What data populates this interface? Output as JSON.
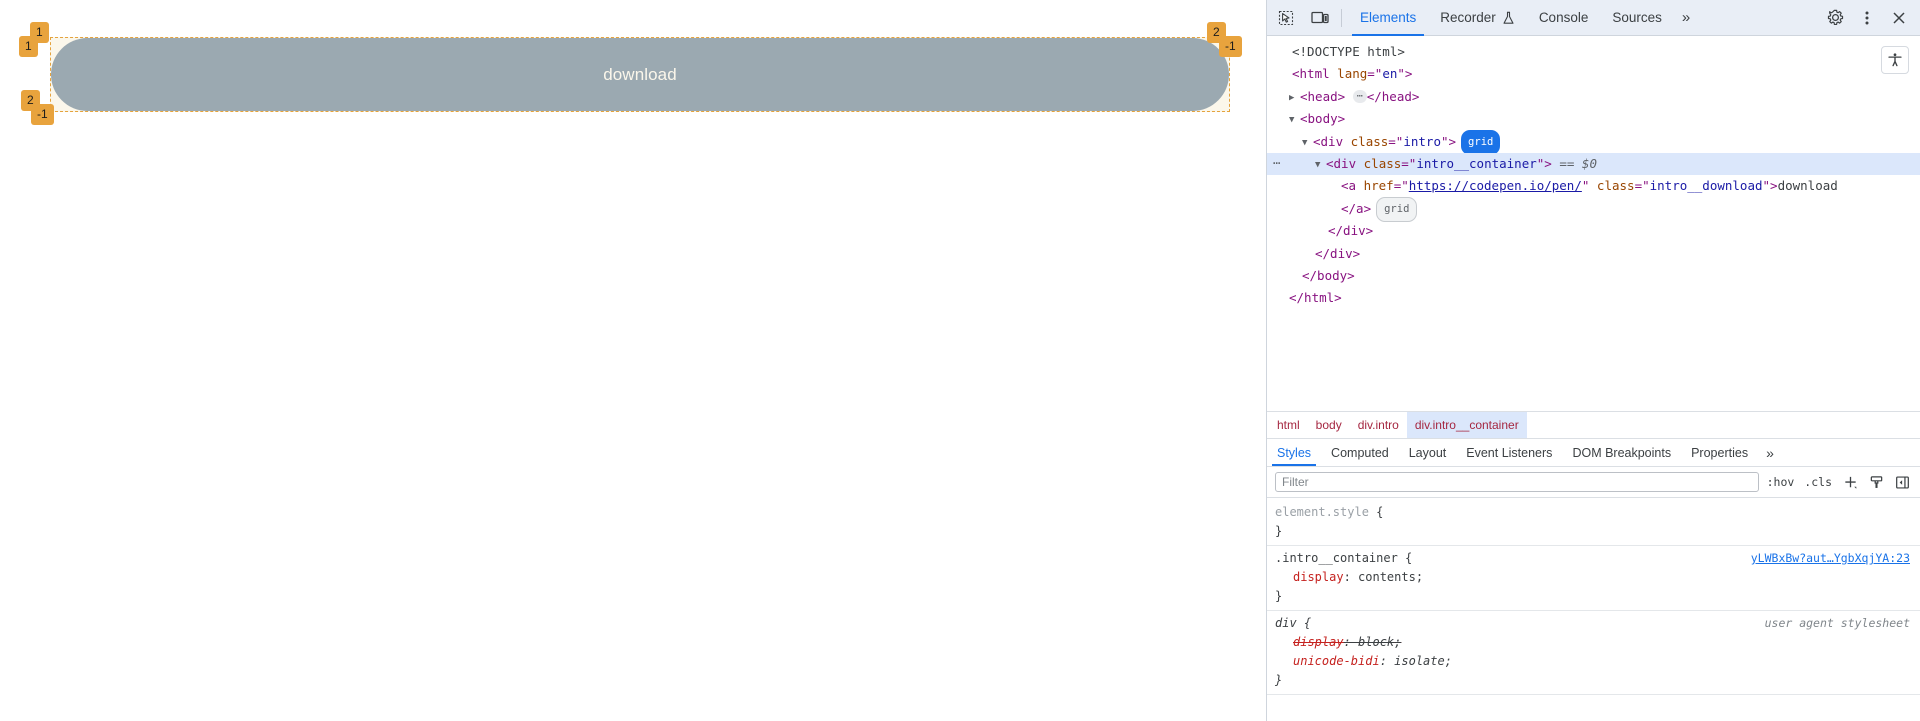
{
  "page": {
    "download_label": "download",
    "download_href": "https://codepen.io/pen/",
    "accent_blue": "#2b527e",
    "grid_overlay_color": "#e8a33d",
    "grid_badges": [
      {
        "label": "1"
      },
      {
        "label": "1"
      },
      {
        "label": "2"
      },
      {
        "label": "-1"
      },
      {
        "label": "2"
      },
      {
        "label": "-1"
      }
    ]
  },
  "devtools": {
    "toolbar": {
      "inspect_icon": "inspect-cursor-icon",
      "device_icon": "device-toolbar-icon",
      "tabs": [
        {
          "label": "Elements",
          "active": true
        },
        {
          "label": "Recorder",
          "active": false,
          "icon": "flask-icon"
        },
        {
          "label": "Console",
          "active": false
        },
        {
          "label": "Sources",
          "active": false
        }
      ],
      "more_tabs": "»",
      "settings_icon": "gear-icon",
      "menu_icon": "kebab-menu-icon",
      "close_icon": "close-icon"
    },
    "dom": {
      "a11y_icon": "accessibility-icon",
      "lines": [
        {
          "type": "doctype",
          "text": "<!DOCTYPE html>"
        },
        {
          "type": "html",
          "text": "<html lang=\"en\">"
        },
        {
          "type": "head",
          "text": "<head>",
          "close": "</head>"
        },
        {
          "type": "body",
          "text": "<body>"
        },
        {
          "type": "intro",
          "tag": "div",
          "attr": "class",
          "value": "intro",
          "badge": "grid"
        },
        {
          "type": "container",
          "tag": "div",
          "attr": "class",
          "value": "intro__container",
          "selected": "== $0"
        },
        {
          "type": "anchor",
          "tag": "a",
          "href": "https://codepen.io/pen/",
          "cls": "intro__download",
          "text": "download"
        },
        {
          "type": "aclose",
          "text": "</a>",
          "badge": "grid"
        },
        {
          "type": "close",
          "text": "</div>"
        },
        {
          "type": "close",
          "text": "</div>"
        },
        {
          "type": "close",
          "text": "</body>"
        },
        {
          "type": "close",
          "text": "</html>"
        }
      ],
      "doctype": "<!DOCTYPE html>",
      "html_open_tag": "html",
      "html_lang_attr": "lang",
      "html_lang_value": "en",
      "head_tag": "head",
      "body_tag": "body",
      "div_tag": "div",
      "class_attr": "class",
      "intro_class": "intro",
      "container_class": "intro__container",
      "selected_marker": "== $0",
      "a_tag": "a",
      "href_attr": "href",
      "href_value": "https://codepen.io/pen/",
      "download_class": "intro__download",
      "download_text": "download",
      "grid_badge": "grid",
      "close_a": "</a>",
      "close_div": "</div>",
      "close_body": "</body>",
      "close_html": "</html>",
      "close_head": "</head>"
    },
    "breadcrumb": [
      {
        "label": "html",
        "active": false
      },
      {
        "label": "body",
        "active": false
      },
      {
        "label": "div.intro",
        "active": false
      },
      {
        "label": "div.intro__container",
        "active": true
      }
    ],
    "sidebar_tabs": [
      {
        "label": "Styles",
        "active": true
      },
      {
        "label": "Computed",
        "active": false
      },
      {
        "label": "Layout",
        "active": false
      },
      {
        "label": "Event Listeners",
        "active": false
      },
      {
        "label": "DOM Breakpoints",
        "active": false
      },
      {
        "label": "Properties",
        "active": false
      }
    ],
    "sidebar_more": "»",
    "filter": {
      "placeholder": "Filter",
      "value": "",
      "hov_label": ":hov",
      "cls_label": ".cls",
      "new_rule_icon": "plus-icon",
      "class_icon": "paintbrush-icon",
      "sidebar_toggle_icon": "panel-toggle-icon"
    },
    "styles_rules": [
      {
        "selector": "element.style",
        "selector_dim": true,
        "origin": "",
        "declarations": []
      },
      {
        "selector": ".intro__container",
        "selector_dim": false,
        "origin": "yLWBxBw?aut…YgbXqjYA:23",
        "origin_is_link": true,
        "declarations": [
          {
            "prop": "display",
            "value": "contents",
            "struck": false
          }
        ]
      },
      {
        "selector": "div",
        "selector_dim": false,
        "selector_italic": true,
        "origin": "user agent stylesheet",
        "origin_is_link": false,
        "declarations": [
          {
            "prop": "display",
            "value": "block",
            "struck": true
          },
          {
            "prop": "unicode-bidi",
            "value": "isolate",
            "struck": false
          }
        ]
      }
    ]
  }
}
